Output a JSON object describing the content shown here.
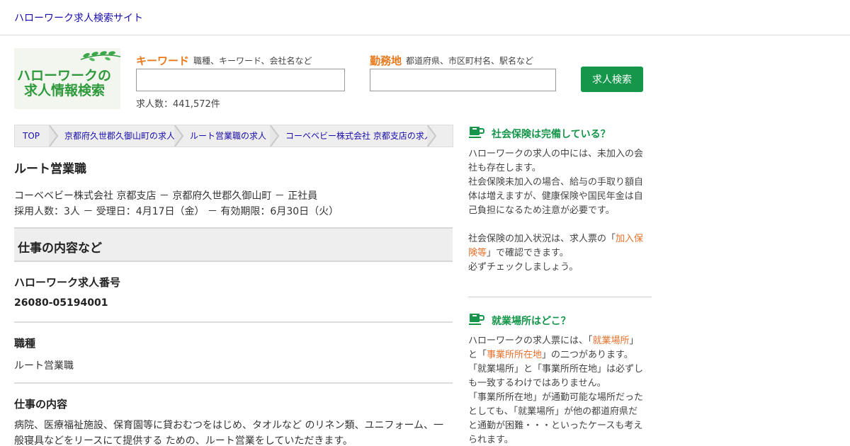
{
  "header": {
    "site_title": "ハローワーク求人検索サイト"
  },
  "logo": {
    "line1": "ハローワークの",
    "line2": "求人情報検索"
  },
  "search": {
    "keyword_label": "キーワード",
    "keyword_hint": "職種、キーワード、会社名など",
    "keyword_value": "",
    "location_label": "勤務地",
    "location_hint": "都道府県、市区町村名、駅名など",
    "location_value": "",
    "job_count": "求人数：441,572件",
    "button": "求人検索"
  },
  "breadcrumb": [
    "TOP",
    "京都府久世郡久御山町の求人",
    "ルート営業職の求人",
    "コーベベビー株式会社 京都支店の求人"
  ],
  "job": {
    "title": "ルート営業職",
    "meta1": "コーベベビー株式会社 京都支店 － 京都府久世郡久御山町 － 正社員",
    "meta2": "採用人数：3人 － 受理日：4月17日（金） － 有効期限：6月30日（火）"
  },
  "section": {
    "title": "仕事の内容など"
  },
  "details": {
    "number_label": "ハローワーク求人番号",
    "number_value": "26080-05194001",
    "occupation_label": "職種",
    "occupation_value": "ルート営業職",
    "content_label": "仕事の内容",
    "content_value": "病院、医療福祉施設、保育園等に貸おむつをはじめ、タオルなど のリネン類、ユニフォーム、一般寝具などをリースにて提供する ための、ルート営業をしていただきます。"
  },
  "sidebar": {
    "insurance_title": "社会保険は完備している？",
    "insurance_p1": "ハローワークの求人の中には、未加入の会社も存在します。",
    "insurance_p2": "社会保険未加入の場合、給与の手取り額自体は増えますが、健康保険や国民年金は自己負担になるため注意が必要です。",
    "insurance_p3_a": "社会保険の加入状況は、求人票の「",
    "insurance_p3_link": "加入保険等",
    "insurance_p3_b": "」で確認できます。",
    "insurance_p4": "必ずチェックしましょう。",
    "workplace_title": "就業場所はどこ？",
    "workplace_p1_a": "ハローワークの求人票には、「",
    "workplace_p1_link1": "就業場所",
    "workplace_p1_b": "」と「",
    "workplace_p1_link2": "事業所所在地",
    "workplace_p1_c": "」の二つがあります。",
    "workplace_p2": "「就業場所」と「事業所所在地」は必ずしも一致するわけではありません。",
    "workplace_p3": "「事業所所在地」が通勤可能な場所だったとしても、「就業場所」が他の都道府県だと通勤が困難・・・といったケースも考えられます。"
  },
  "colors": {
    "accent_green": "#15964a",
    "accent_orange": "#e87a1e",
    "link_blue": "#1a0dab"
  }
}
